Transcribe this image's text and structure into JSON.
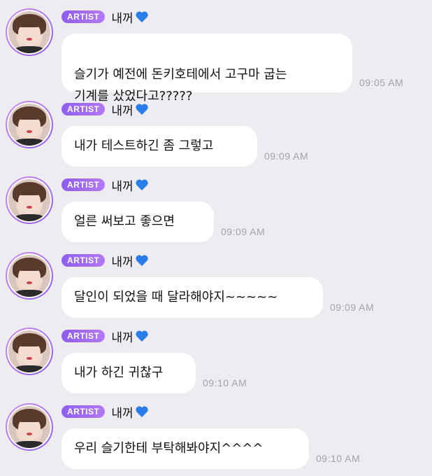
{
  "badge_label": "ARTIST",
  "sender_name": "내꺼",
  "messages": [
    {
      "text": "슬기가 예전에 돈키호테에서 고구마 굽는\n기계를 샀었다고?????",
      "time": "09:05 AM"
    },
    {
      "text": "내가 테스트하긴 좀 그렇고",
      "time": "09:09 AM"
    },
    {
      "text": "얼른 써보고 좋으면",
      "time": "09:09 AM"
    },
    {
      "text": "달인이 되었을 때 달라해야지~~~~~",
      "time": "09:09 AM"
    },
    {
      "text": "내가 하긴 귀찮구",
      "time": "09:10 AM"
    },
    {
      "text": "우리 슬기한테 부탁해봐야지^^^^",
      "time": "09:10 AM"
    }
  ],
  "colors": {
    "background": "#ececf1",
    "badge": "#9a66f0",
    "heart": "#2b7de9",
    "bubble": "#ffffff"
  },
  "icons": {
    "heart": "blue-heart-icon"
  }
}
